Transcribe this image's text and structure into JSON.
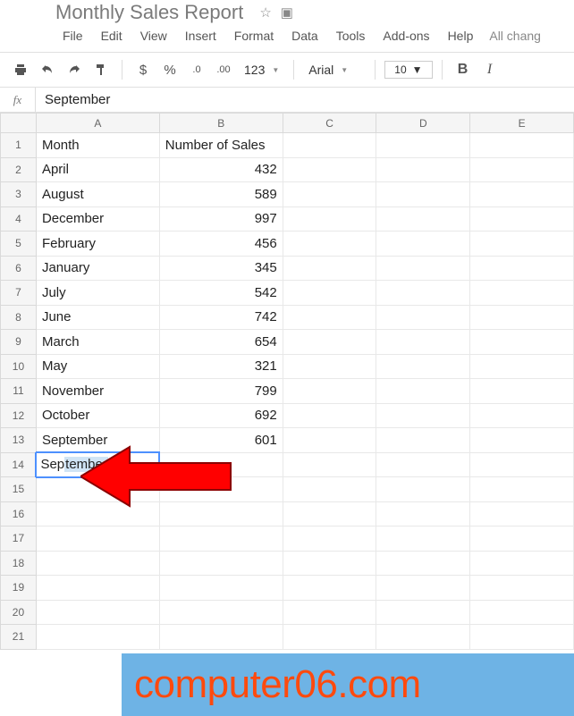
{
  "doc": {
    "title": "Monthly Sales Report"
  },
  "menus": {
    "file": "File",
    "edit": "Edit",
    "view": "View",
    "insert": "Insert",
    "format": "Format",
    "data": "Data",
    "tools": "Tools",
    "addons": "Add-ons",
    "help": "Help",
    "trail": "All chang"
  },
  "toolbar": {
    "currency": "$",
    "percent": "%",
    "dec_dec": ".0",
    "dec_inc": ".00",
    "format_more": "123",
    "font": "Arial",
    "font_size": "10",
    "bold": "B",
    "italic": "I"
  },
  "formula": {
    "fx": "fx",
    "value": "September"
  },
  "columns": {
    "A": "A",
    "B": "B",
    "C": "C",
    "D": "D",
    "E": "E"
  },
  "rows": [
    {
      "n": "1",
      "A": "Month",
      "B": "Number of Sales",
      "B_align": "left"
    },
    {
      "n": "2",
      "A": "April",
      "B": "432"
    },
    {
      "n": "3",
      "A": "August",
      "B": "589"
    },
    {
      "n": "4",
      "A": "December",
      "B": "997"
    },
    {
      "n": "5",
      "A": "February",
      "B": "456"
    },
    {
      "n": "6",
      "A": "January",
      "B": "345"
    },
    {
      "n": "7",
      "A": "July",
      "B": "542"
    },
    {
      "n": "8",
      "A": "June",
      "B": "742"
    },
    {
      "n": "9",
      "A": "March",
      "B": "654"
    },
    {
      "n": "10",
      "A": "May",
      "B": "321"
    },
    {
      "n": "11",
      "A": "November",
      "B": "799"
    },
    {
      "n": "12",
      "A": "October",
      "B": "692"
    },
    {
      "n": "13",
      "A": "September",
      "B": "601"
    },
    {
      "n": "14",
      "editing": true,
      "typed": "Sep",
      "suggest": "tember"
    },
    {
      "n": "15"
    },
    {
      "n": "16"
    },
    {
      "n": "17"
    },
    {
      "n": "18"
    },
    {
      "n": "19"
    },
    {
      "n": "20"
    },
    {
      "n": "21"
    }
  ],
  "watermark": "computer06.com"
}
